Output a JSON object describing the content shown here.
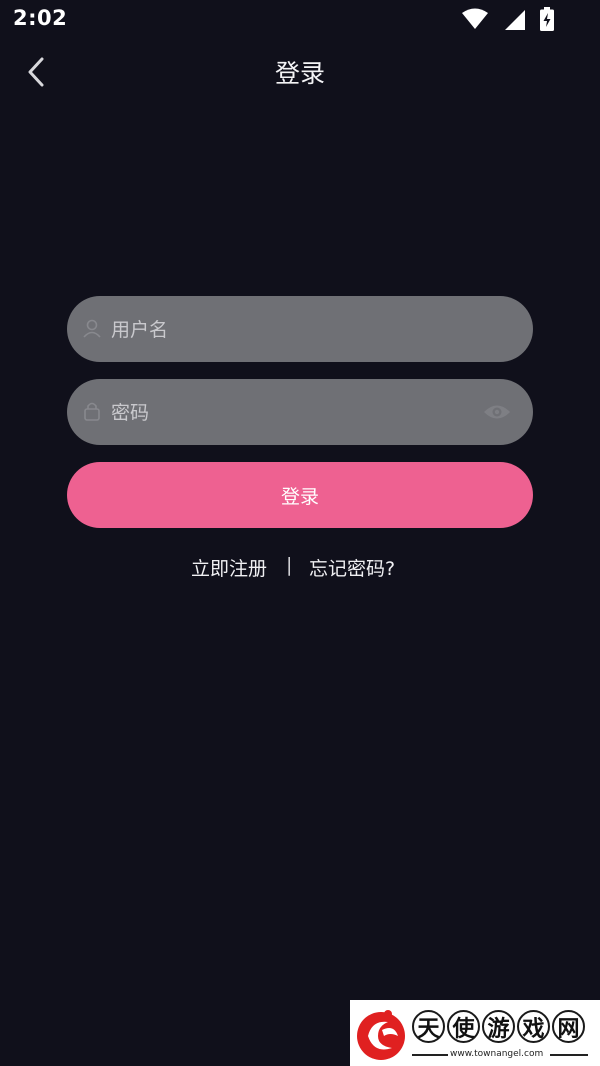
{
  "status_bar": {
    "time": "2:02",
    "icons": [
      "wifi-icon",
      "signal-icon",
      "battery-charging-icon"
    ]
  },
  "header": {
    "title": "登录",
    "back_icon": "chevron-left-icon"
  },
  "form": {
    "username": {
      "value": "",
      "placeholder": "用户名",
      "icon": "user-icon"
    },
    "password": {
      "value": "",
      "placeholder": "密码",
      "icon": "lock-icon",
      "toggle_icon": "eye-icon"
    },
    "submit_label": "登录"
  },
  "links": {
    "register": "立即注册",
    "divider": "|",
    "forgot": "忘记密码?"
  },
  "watermark": {
    "chars": [
      "天",
      "使",
      "游",
      "戏",
      "网"
    ],
    "url": "www.townangel.com"
  },
  "colors": {
    "background": "#10101b",
    "field": "#6f7075",
    "accent": "#ee6191"
  }
}
